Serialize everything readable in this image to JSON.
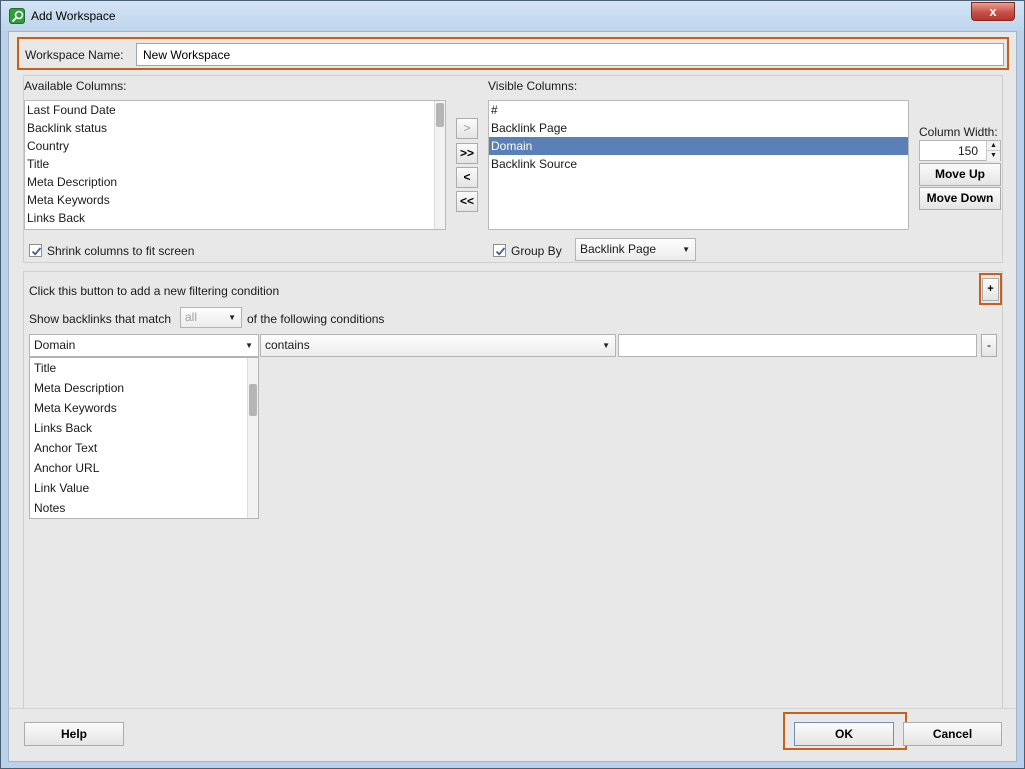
{
  "window": {
    "title": "Add Workspace",
    "close_glyph": "x",
    "app_icon": "search-key-icon"
  },
  "workspace": {
    "label": "Workspace Name:",
    "value": "New Workspace"
  },
  "available_columns": {
    "label": "Available Columns:",
    "items": [
      "Last Found Date",
      "Backlink status",
      "Country",
      "Title",
      "Meta Description",
      "Meta Keywords",
      "Links Back"
    ]
  },
  "transfer_buttons": {
    "add": ">",
    "add_all": ">>",
    "remove": "<",
    "remove_all": "<<"
  },
  "visible_columns": {
    "label": "Visible Columns:",
    "items": [
      "#",
      "Backlink Page",
      "Domain",
      "Backlink Source"
    ],
    "selected_index": 2
  },
  "column_width": {
    "label": "Column Width:",
    "value": "150"
  },
  "move_up_label": "Move Up",
  "move_down_label": "Move Down",
  "shrink_checkbox": {
    "label": "Shrink columns to fit screen",
    "checked": true
  },
  "group_by": {
    "label": "Group By",
    "checked": true,
    "value": "Backlink Page"
  },
  "filter": {
    "hint": "Click this button to add a new filtering condition",
    "add_button": "+",
    "match_prefix": "Show backlinks that match",
    "match_value": "all",
    "match_suffix": "of the following conditions",
    "field_value": "Domain",
    "operator_value": "contains",
    "value_input": "",
    "remove_button": "-",
    "dropdown_options": [
      "Title",
      "Meta Description",
      "Meta Keywords",
      "Links Back",
      "Anchor Text",
      "Anchor URL",
      "Link Value",
      "Notes"
    ]
  },
  "footer": {
    "help": "Help",
    "ok": "OK",
    "cancel": "Cancel"
  },
  "colors": {
    "highlight": "#c9601a",
    "selection": "#5b80b7"
  }
}
